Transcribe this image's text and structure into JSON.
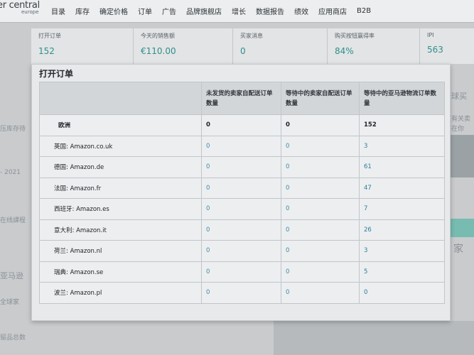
{
  "nav": {
    "brand": "er central",
    "brand_sub": "europe",
    "items": [
      "目录",
      "库存",
      "确定价格",
      "订单",
      "广告",
      "品牌旗舰店",
      "增长",
      "数据报告",
      "绩效",
      "应用商店",
      "B2B"
    ]
  },
  "metrics": [
    {
      "label": "打开订单",
      "value": "152"
    },
    {
      "label": "今天的销售额",
      "value": "€110.00"
    },
    {
      "label": "买家消息",
      "value": "0"
    },
    {
      "label": "购买按钮赢得率",
      "value": "84%"
    },
    {
      "label": "IPI",
      "value": "563"
    }
  ],
  "background_fragments": {
    "left": [
      "压库存待",
      "- 2021",
      "在线課程",
      "亚马逊",
      "全球家",
      "留品总数"
    ],
    "right": [
      "全球买",
      "取有关卖",
      "容在你",
      "家"
    ]
  },
  "popup": {
    "title": "打开订单",
    "columns": [
      "",
      "未发货的卖家自配送订单数量",
      "等待中的卖家自配送订单数量",
      "等待中的亚马逊物流订单数量"
    ],
    "rows": [
      {
        "market": "欧洲",
        "c1": "0",
        "c2": "0",
        "c3": "152"
      },
      {
        "market": "英国: Amazon.co.uk",
        "c1": "0",
        "c2": "0",
        "c3": "3"
      },
      {
        "market": "德国: Amazon.de",
        "c1": "0",
        "c2": "0",
        "c3": "61"
      },
      {
        "market": "法国: Amazon.fr",
        "c1": "0",
        "c2": "0",
        "c3": "47"
      },
      {
        "market": "西班牙: Amazon.es",
        "c1": "0",
        "c2": "0",
        "c3": "7"
      },
      {
        "market": "意大利: Amazon.it",
        "c1": "0",
        "c2": "0",
        "c3": "26"
      },
      {
        "market": "荷兰: Amazon.nl",
        "c1": "0",
        "c2": "0",
        "c3": "3"
      },
      {
        "market": "瑞典: Amazon.se",
        "c1": "0",
        "c2": "0",
        "c3": "5"
      },
      {
        "market": "波兰: Amazon.pl",
        "c1": "0",
        "c2": "0",
        "c3": "0"
      }
    ]
  },
  "colors": {
    "metric_value": "#2f8f8a",
    "table_value": "#2e7e98",
    "accent_green": "#5bb5a7"
  }
}
